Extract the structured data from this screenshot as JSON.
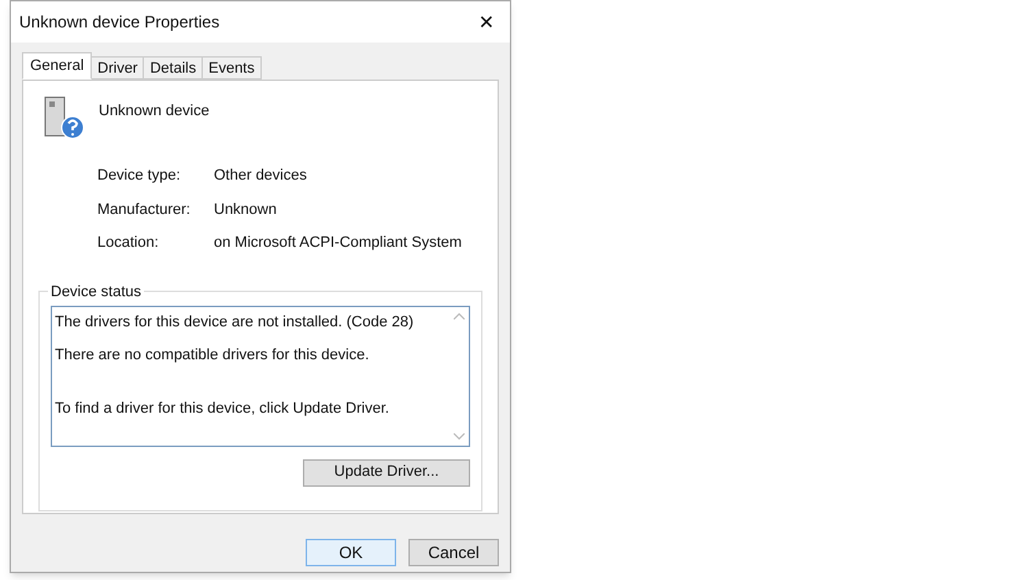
{
  "window": {
    "title": "Unknown device Properties",
    "close": "✕"
  },
  "tabs": [
    {
      "label": "General",
      "selected": true
    },
    {
      "label": "Driver",
      "selected": false
    },
    {
      "label": "Details",
      "selected": false
    },
    {
      "label": "Events",
      "selected": false
    }
  ],
  "device": {
    "name": "Unknown device"
  },
  "properties": [
    {
      "label": "Device type:",
      "value": "Other devices"
    },
    {
      "label": "Manufacturer:",
      "value": "Unknown"
    },
    {
      "label": "Location:",
      "value": "on Microsoft ACPI-Compliant System"
    }
  ],
  "device_status": {
    "title": "Device status",
    "lines": [
      {
        "text": "The drivers for this device are not installed. (Code 28)",
        "blank_line_before": false
      },
      {
        "text": "There are no compatible drivers for this device.",
        "blank_line_before": false
      },
      {
        "text": "To find a driver for this device, click Update Driver.",
        "blank_line_before": true
      }
    ]
  },
  "update_button": "Update Driver...",
  "buttons": [
    {
      "label": "OK",
      "default": true
    },
    {
      "label": "Cancel",
      "default": false
    }
  ]
}
